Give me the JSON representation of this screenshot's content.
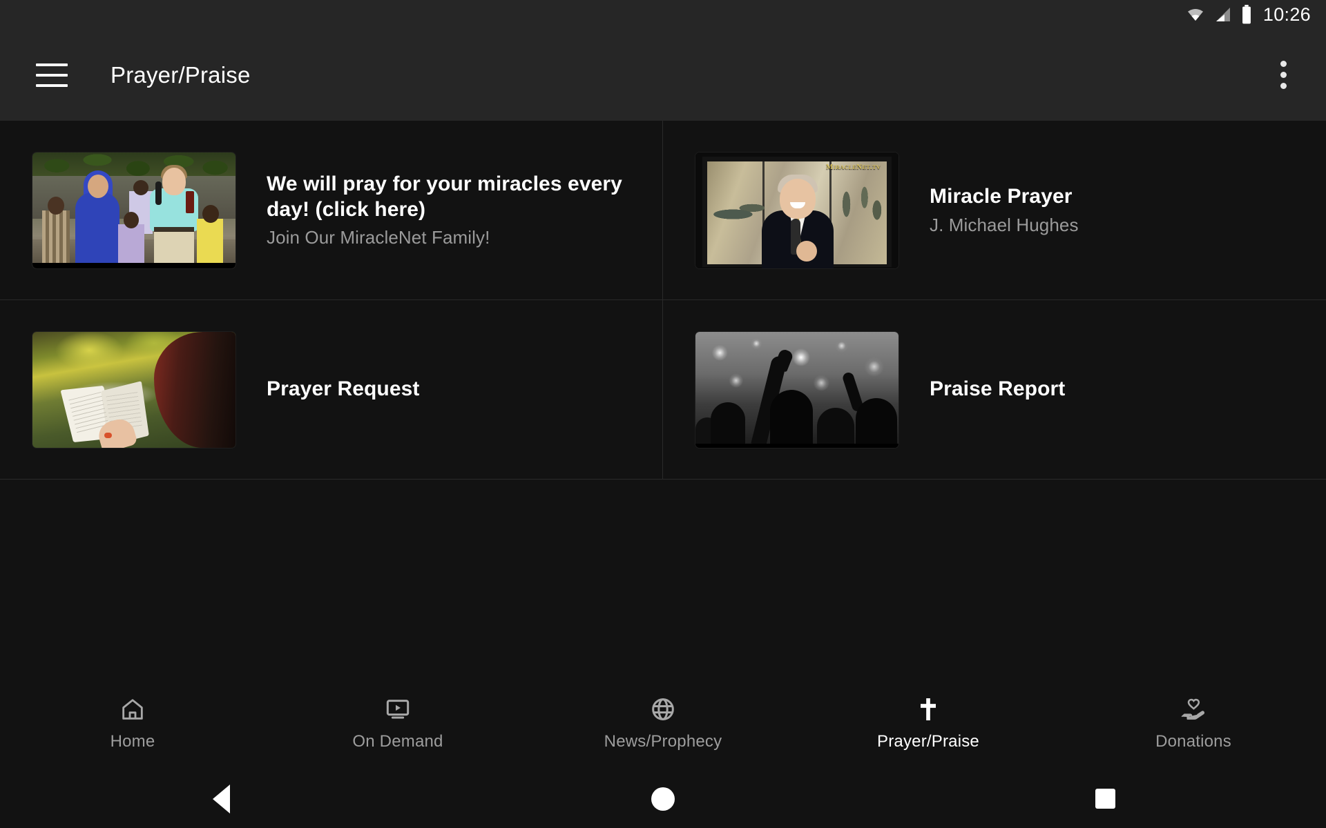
{
  "status_bar": {
    "wifi_icon": "wifi-icon",
    "signal_icon": "cell-signal-icon",
    "battery_icon": "battery-full-icon",
    "time": "10:26"
  },
  "app_bar": {
    "menu_icon": "hamburger-menu-icon",
    "title": "Prayer/Praise",
    "overflow_icon": "more-vertical-icon"
  },
  "colors": {
    "app_bar_bg": "#262626",
    "content_bg": "#121212",
    "divider": "#2a2a2a",
    "primary_text": "#ffffff",
    "secondary_text": "#9b9b9b",
    "nav_inactive": "#9d9d9d",
    "nav_active": "#ffffff"
  },
  "cards": [
    {
      "title": "We will pray for your miracles every day! (click here)",
      "subtitle": "Join Our MiracleNet Family!",
      "thumbnail": "outdoor-crowd-preacher-thumbnail"
    },
    {
      "title": "Miracle Prayer",
      "subtitle": "J. Michael Hughes",
      "thumbnail": "miracle-prayer-host-thumbnail",
      "watermark": "MiracleNet.tv"
    },
    {
      "title": "Prayer Request",
      "subtitle": "",
      "thumbnail": "open-bible-thumbnail"
    },
    {
      "title": "Praise Report",
      "subtitle": "",
      "thumbnail": "worship-crowd-thumbnail"
    }
  ],
  "bottom_nav": {
    "items": [
      {
        "label": "Home",
        "icon": "home-icon",
        "active": false
      },
      {
        "label": "On Demand",
        "icon": "ondemand-video-icon",
        "active": false
      },
      {
        "label": "News/Prophecy",
        "icon": "globe-icon",
        "active": false
      },
      {
        "label": "Prayer/Praise",
        "icon": "cross-icon",
        "active": true
      },
      {
        "label": "Donations",
        "icon": "hand-heart-icon",
        "active": false
      }
    ]
  },
  "system_nav": {
    "back": "back-triangle-icon",
    "home": "home-circle-icon",
    "recents": "recents-square-icon"
  }
}
